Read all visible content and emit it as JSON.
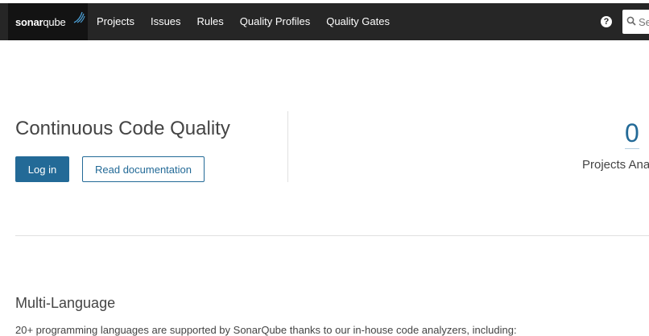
{
  "header": {
    "logo_text_bold": "sonar",
    "logo_text_light": "qube",
    "nav": [
      {
        "label": "Projects"
      },
      {
        "label": "Issues"
      },
      {
        "label": "Rules"
      },
      {
        "label": "Quality Profiles"
      },
      {
        "label": "Quality Gates"
      }
    ],
    "help_glyph": "?",
    "search": {
      "placeholder": "Search"
    }
  },
  "hero": {
    "title": "Continuous Code Quality",
    "login_label": "Log in",
    "docs_label": "Read documentation"
  },
  "stats": {
    "count": "0",
    "label": "Projects Analyzed"
  },
  "sections": {
    "multi_language": {
      "title": "Multi-Language",
      "text": "20+ programming languages are supported by SonarQube thanks to our in-house code analyzers, including:"
    }
  },
  "colors": {
    "topbar": "#262626",
    "logo_bg": "#131313",
    "accent": "#236a97"
  }
}
